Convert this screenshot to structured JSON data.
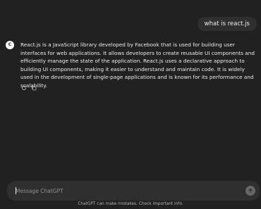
{
  "conversation": {
    "user_message": "what is react.js",
    "assistant_avatar_letter": "C",
    "assistant_message": "React.js is a JavaScript library developed by Facebook that is used for building user interfaces for web applications. It allows developers to create reusable UI components and efficiently manage the state of the application. React.js uses a declarative approach to building UI components, making it easier to understand and maintain code. It is widely used in the development of single-page applications and is known for its performance and scalability.",
    "actions": {
      "regenerate_icon": "refresh-icon",
      "copy_icon": "copy-icon"
    }
  },
  "composer": {
    "placeholder": "Message ChatGPT",
    "value": "",
    "send_icon": "arrow-up-icon"
  },
  "footer": {
    "disclaimer": "ChatGPT can make mistakes. Check important info."
  },
  "colors": {
    "background": "#212121",
    "bubble": "#2f2f2f",
    "text": "#ececec",
    "muted": "#b4b4b4",
    "send_button_disabled": "#676767"
  }
}
